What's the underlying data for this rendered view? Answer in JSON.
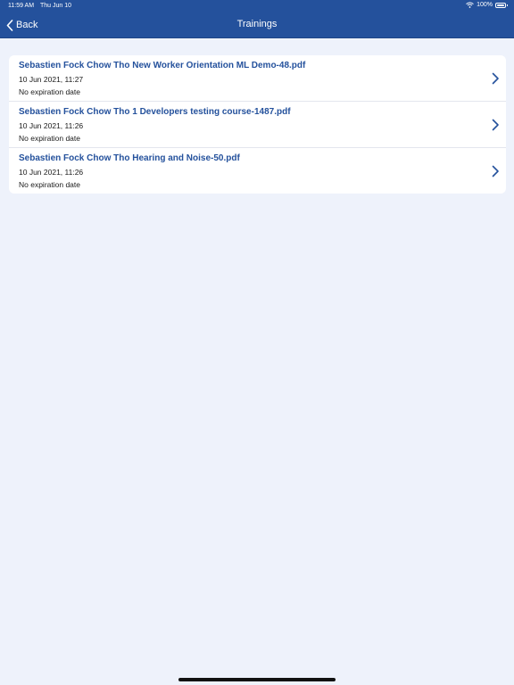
{
  "status_bar": {
    "time": "11:59 AM",
    "date": "Thu Jun 10",
    "battery": "100%",
    "icons": [
      "wifi-icon",
      "battery-icon"
    ]
  },
  "nav": {
    "back_label": "Back",
    "title": "Trainings",
    "back_icon": "chevron-left-icon"
  },
  "trainings": [
    {
      "title": "Sebastien Fock Chow Tho New Worker Orientation  ML Demo-48.pdf",
      "date": "10 Jun 2021, 11:27",
      "expiry": "No expiration date"
    },
    {
      "title": "Sebastien Fock Chow Tho 1 Developers testing course-1487.pdf",
      "date": "10 Jun 2021, 11:26",
      "expiry": "No expiration date"
    },
    {
      "title": "Sebastien Fock Chow Tho Hearing and Noise-50.pdf",
      "date": "10 Jun 2021, 11:26",
      "expiry": "No expiration date"
    }
  ],
  "colors": {
    "header": "#24519c",
    "background": "#eef2fb",
    "title_text": "#24519c",
    "chevron": "#24519c"
  }
}
